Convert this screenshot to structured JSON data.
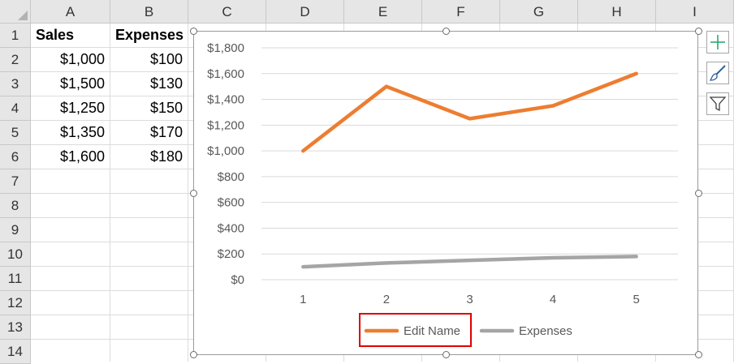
{
  "spreadsheet": {
    "columns": [
      "A",
      "B",
      "C",
      "D",
      "E",
      "F",
      "G",
      "H",
      "I"
    ],
    "rows": [
      "1",
      "2",
      "3",
      "4",
      "5",
      "6",
      "7",
      "8",
      "9",
      "10",
      "11",
      "12",
      "13",
      "14"
    ],
    "cells": [
      [
        "Sales",
        "Expenses"
      ],
      [
        "$1,000",
        "$100"
      ],
      [
        "$1,500",
        "$130"
      ],
      [
        "$1,250",
        "$150"
      ],
      [
        "$1,350",
        "$170"
      ],
      [
        "$1,600",
        "$180"
      ]
    ]
  },
  "chart_data": {
    "type": "line",
    "x": [
      1,
      2,
      3,
      4,
      5
    ],
    "series": [
      {
        "name": "Edit Name",
        "values": [
          1000,
          1500,
          1250,
          1350,
          1600
        ],
        "color": "#ed7d31"
      },
      {
        "name": "Expenses",
        "values": [
          100,
          130,
          150,
          170,
          180
        ],
        "color": "#a5a5a5"
      }
    ],
    "ylim": [
      0,
      1800
    ],
    "yticks": [
      "$0",
      "$200",
      "$400",
      "$600",
      "$800",
      "$1,000",
      "$1,200",
      "$1,400",
      "$1,600",
      "$1,800"
    ],
    "xticks": [
      "1",
      "2",
      "3",
      "4",
      "5"
    ],
    "grid": true,
    "legend": "bottom"
  },
  "chart_tools": {
    "elements_icon": "plus-icon",
    "styles_icon": "brush-icon",
    "filters_icon": "funnel-icon",
    "accent_green": "#21a366"
  }
}
